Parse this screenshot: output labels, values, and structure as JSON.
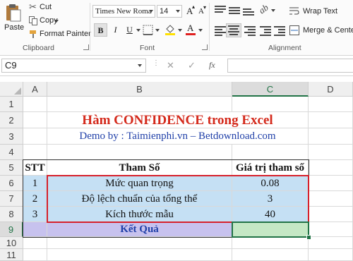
{
  "ribbon": {
    "clipboard": {
      "paste": "Paste",
      "cut": "Cut",
      "copy": "Copy",
      "format_painter": "Format Painter",
      "group": "Clipboard"
    },
    "font": {
      "name": "Times New Roma",
      "size": "14",
      "bold": "B",
      "italic": "I",
      "underline": "U",
      "group": "Font"
    },
    "alignment": {
      "wrap_text": "Wrap Text",
      "merge_center": "Merge & Center",
      "group": "Alignment"
    }
  },
  "formula_bar": {
    "name_box": "C9",
    "fx": "fx",
    "cancel": "✕",
    "enter": "✓"
  },
  "columns": [
    "A",
    "B",
    "C",
    "D"
  ],
  "rows": [
    "1",
    "2",
    "3",
    "4",
    "5",
    "6",
    "7",
    "8",
    "9",
    "10",
    "11"
  ],
  "sheet": {
    "title": "Hàm CONFIDENCE trong Excel",
    "demo_prefix": "Demo by : ",
    "demo_sites": "Taimienphi.vn – Betdownload.com",
    "table": {
      "headers": [
        "STT",
        "Tham Số",
        "Giá trị tham số"
      ],
      "rows": [
        {
          "stt": "1",
          "param": "Mức quan trọng",
          "value": "0.08"
        },
        {
          "stt": "2",
          "param": "Độ lệch chuẩn của tổng thể",
          "value": "3"
        },
        {
          "stt": "3",
          "param": "Kích thước mẫu",
          "value": "40"
        }
      ],
      "result_label": "Kết Quả"
    }
  },
  "colors": {
    "title": "#d42a1c",
    "demo": "#1f3fa8",
    "blue_fill": "#c5e0f4",
    "purple_fill": "#c7c2ee",
    "red_border": "#d6202a",
    "selection": "#217346"
  }
}
